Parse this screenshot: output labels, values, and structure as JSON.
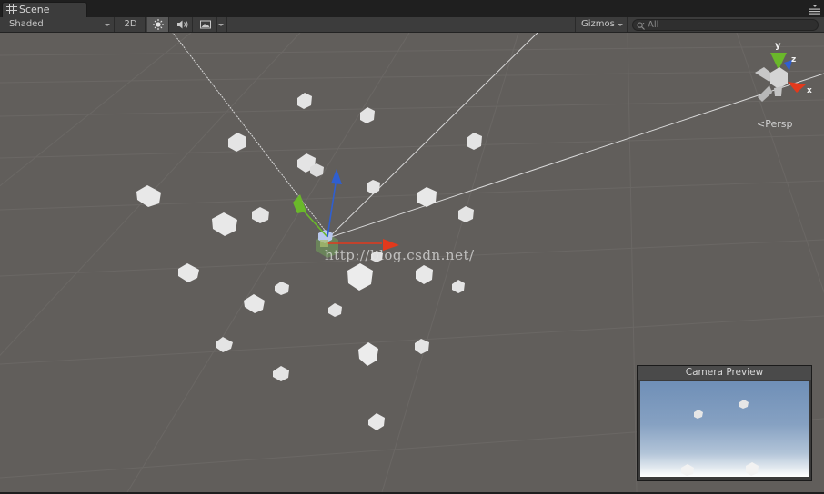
{
  "tabs": [
    {
      "label": "Scene"
    }
  ],
  "toolbar": {
    "shading_mode": "Shaded",
    "toggle_2d": "2D",
    "gizmos_label": "Gizmos",
    "search_placeholder": "All"
  },
  "scene": {
    "projection_label": "Persp",
    "axis_labels": {
      "x": "x",
      "y": "y",
      "z": "z"
    },
    "watermark": "http://blog.csdn.net/"
  },
  "camera_preview": {
    "title": "Camera Preview"
  },
  "colors": {
    "viewport_background": "#615e5b",
    "x_axis": "#e2391c",
    "y_axis": "#6ab82a",
    "z_axis": "#2f5fd0",
    "toolbar": "#3c3c3c",
    "tab_bar": "#1f1f1f"
  },
  "icons": {
    "scene_tab": "grid-icon",
    "lighting": "sun-icon",
    "audio": "speaker-icon",
    "effects": "image-icon",
    "search": "search-icon",
    "tab_menu": "menu-icon"
  }
}
